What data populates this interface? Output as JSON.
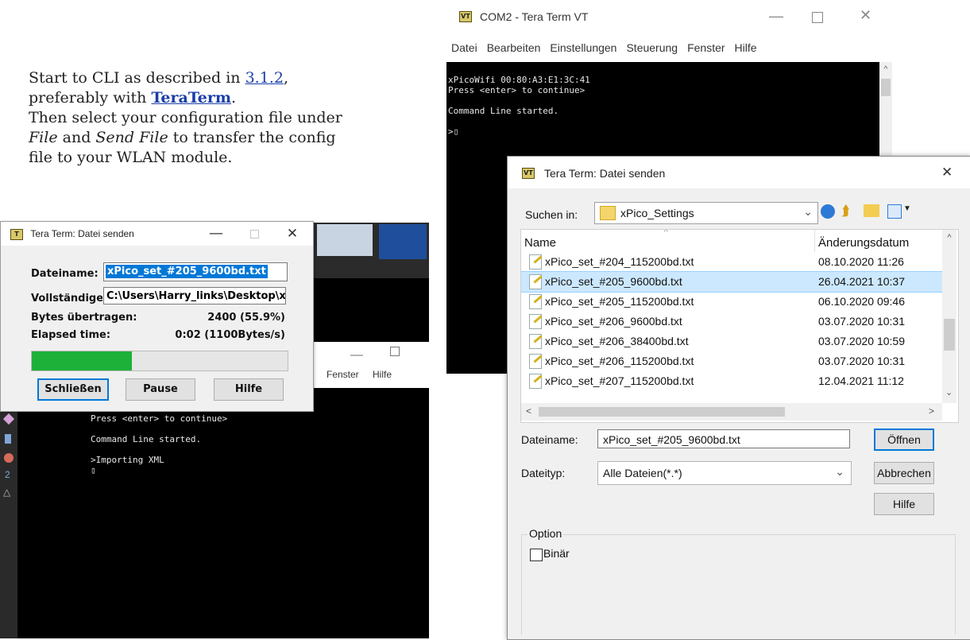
{
  "doc": {
    "line1_a": "Start to CLI as described in ",
    "line1_link": "3.1.2",
    "line1_b": ",",
    "line2_a": "preferably with ",
    "line2_link": "TeraTerm",
    "line2_b": ".",
    "line3": "Then select your configuration file under",
    "line4_i1": "File",
    "line4_a": " and ",
    "line4_i2": "Send File",
    "line4_b": " to transfer the config",
    "line5": "file to your WLAN module."
  },
  "progress_dialog": {
    "icon": "T",
    "title": "Tera Term: Datei senden",
    "filename_label": "Dateiname:",
    "filename_value": "xPico_set_#205_9600bd.txt",
    "fullpath_label": "Vollständige",
    "fullpath_value": "C:\\Users\\Harry_links\\Desktop\\x",
    "bytes_label": "Bytes übertragen:",
    "bytes_value": "2400 (55.9%)",
    "elapsed_label": "Elapsed time:",
    "elapsed_value": "0:02 (1100Bytes/s)",
    "progress": 0.559,
    "close_button": "Schließen",
    "pause_button": "Pause",
    "help_button": "Hilfe",
    "progress_color": "#1db13a"
  },
  "bg_terminal": {
    "menu_fenster": "Fenster",
    "menu_hilfe": "Hilfe",
    "lines": [
      "Press <enter> to continue>",
      "",
      "Command Line started.",
      "",
      ">Importing XML",
      "▯"
    ]
  },
  "terminal": {
    "icon": "VT",
    "title": "COM2 - Tera Term VT",
    "menu": [
      "Datei",
      "Bearbeiten",
      "Einstellungen",
      "Steuerung",
      "Fenster",
      "Hilfe"
    ],
    "lines": [
      "xPicoWifi 00:80:A3:E1:3C:41",
      "Press <enter> to continue>",
      "",
      "Command Line started.",
      "",
      ">▯"
    ]
  },
  "file_dialog": {
    "icon": "VT",
    "title": "Tera Term: Datei senden",
    "lookin_label": "Suchen in:",
    "lookin_value": "xPico_Settings",
    "col_name": "Name",
    "col_date": "Änderungsdatum",
    "rows": [
      {
        "name": "xPico_set_#204_115200bd.txt",
        "date": "08.10.2020 11:26"
      },
      {
        "name": "xPico_set_#205_9600bd.txt",
        "date": "26.04.2021 10:37"
      },
      {
        "name": "xPico_set_#205_115200bd.txt",
        "date": "06.10.2020 09:46"
      },
      {
        "name": "xPico_set_#206_9600bd.txt",
        "date": "03.07.2020 10:31"
      },
      {
        "name": "xPico_set_#206_38400bd.txt",
        "date": "03.07.2020 10:59"
      },
      {
        "name": "xPico_set_#206_115200bd.txt",
        "date": "03.07.2020 10:31"
      },
      {
        "name": "xPico_set_#207_115200bd.txt",
        "date": "12.04.2021 11:12"
      }
    ],
    "filename_label": "Dateiname:",
    "filename_value": "xPico_set_#205_9600bd.txt",
    "filetype_label": "Dateityp:",
    "filetype_value": "Alle Dateien(*.*)",
    "open_button": "Öffnen",
    "cancel_button": "Abbrechen",
    "help_button": "Hilfe",
    "option_label": "Option",
    "binary_label": "Binär",
    "selected_color": "#cce8ff"
  }
}
